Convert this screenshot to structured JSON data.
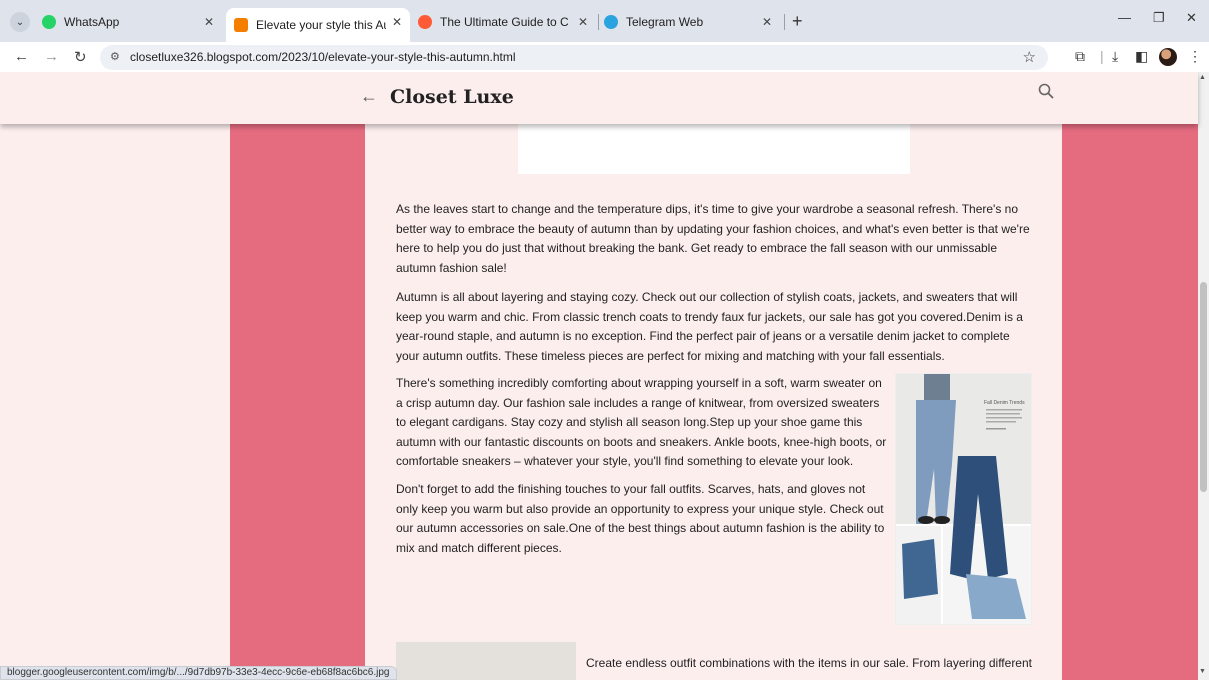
{
  "browser": {
    "tabs": [
      {
        "title": "WhatsApp",
        "favicon": "whatsapp-icon"
      },
      {
        "title": "Elevate your style this Autumn",
        "favicon": "blogger-icon"
      },
      {
        "title": "The Ultimate Guide to Content",
        "favicon": "guide-icon"
      },
      {
        "title": "Telegram Web",
        "favicon": "telegram-icon"
      }
    ],
    "url": "closetluxe326.blogspot.com/2023/10/elevate-your-style-this-autumn.html",
    "status_url": "blogger.googleusercontent.com/img/b/.../9d7db97b-33e3-4ecc-9c6e-eb68f8ac6bc6.jpg"
  },
  "blog": {
    "title": "Closet Luxe"
  },
  "post": {
    "paragraphs": [
      "As the leaves start to change and the temperature dips, it's time to give your wardrobe a seasonal refresh. There's no better way to embrace the beauty of autumn than by updating your fashion choices, and what's even better is that we're here to help you do just that without breaking the bank. Get ready to embrace the fall season with our unmissable autumn fashion sale!",
      "Autumn is all about layering and staying cozy. Check out our collection of stylish coats, jackets, and sweaters that will keep you warm and chic. From classic trench coats to trendy faux fur jackets, our sale has got you covered.Denim is a year-round staple, and autumn is no exception. Find the perfect pair of jeans or a versatile denim jacket to complete your autumn outfits. These timeless pieces are perfect for mixing and matching with your fall essentials.",
      "There's something incredibly comforting about wrapping yourself in a soft, warm sweater on a crisp autumn day. Our fashion sale includes a range of knitwear, from oversized sweaters to elegant cardigans. Stay cozy and stylish all season long.Step up your shoe game this autumn with our fantastic discounts on boots and sneakers. Ankle boots, knee-high boots, or comfortable sneakers – whatever your style, you'll find something to elevate your look.",
      "Don't forget to add the finishing touches to your fall outfits. Scarves, hats, and gloves not only keep you warm but also provide an opportunity to express your unique style. Check out our autumn accessories on sale.One of the best things about autumn fashion is the ability to mix and match different pieces.",
      "Create endless outfit combinations with the items in our sale. From layering different"
    ],
    "image_caption": "Fall Denim Trends"
  },
  "colors": {
    "page_bg": "#fdeeee",
    "accent_bands": "#e56b7f",
    "tabbar": "#dfe3eb"
  }
}
